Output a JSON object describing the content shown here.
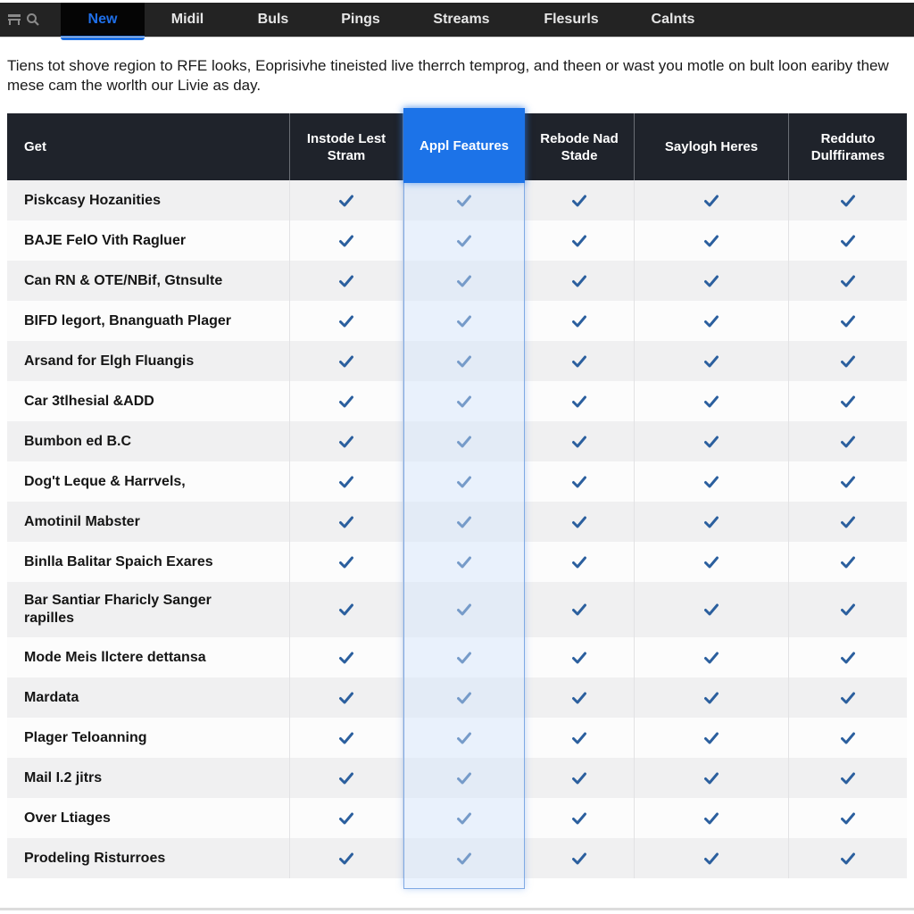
{
  "nav": {
    "icons": [
      "menu-icon",
      "search-icon"
    ],
    "tabs": [
      {
        "label": "New",
        "active": true
      },
      {
        "label": "Midil",
        "active": false
      },
      {
        "label": "Buls",
        "active": false
      },
      {
        "label": "Pings",
        "active": false
      },
      {
        "label": "Streams",
        "active": false
      },
      {
        "label": "Flesurls",
        "active": false
      },
      {
        "label": "Calnts",
        "active": false
      }
    ]
  },
  "intro": {
    "text": "Tiens tot shove region to RFE looks, Eoprisivhe tineisted live therrch temprog, and theen or wast you motle on bult loon eariby thew mese cam the worlth our Livie as day."
  },
  "table": {
    "highlight_color": "#1c73e8",
    "check_color": "#2b5f9e",
    "columns": [
      "Get",
      "Instode Lest Stram",
      "Appl Features",
      "Rebode Nad Stade",
      "Saylogh Heres",
      "Redduto Dulffirames"
    ],
    "highlighted_column_index": 2,
    "rows": [
      {
        "feature": "Piskcasy Hozanities",
        "values": [
          true,
          true,
          true,
          true,
          true
        ]
      },
      {
        "feature": "BAJE FelO Vith Ragluer",
        "values": [
          true,
          true,
          true,
          true,
          true
        ]
      },
      {
        "feature": "Can RN & OTE/NBif, Gtnsulte",
        "values": [
          true,
          true,
          true,
          true,
          true
        ]
      },
      {
        "feature": "BIFD legort, Bnanguath Plager",
        "values": [
          true,
          true,
          true,
          true,
          true
        ]
      },
      {
        "feature": "Arsand for Elgh Fluangis",
        "values": [
          true,
          true,
          true,
          true,
          true
        ]
      },
      {
        "feature": "Car 3tlhesial &ADD",
        "values": [
          true,
          true,
          true,
          true,
          true
        ]
      },
      {
        "feature": "Bumbon ed B.C",
        "values": [
          true,
          true,
          true,
          true,
          true
        ]
      },
      {
        "feature": "Dog't Leque & Harrvels,",
        "values": [
          true,
          true,
          true,
          true,
          true
        ]
      },
      {
        "feature": "Amotinil Mabster",
        "values": [
          true,
          true,
          true,
          true,
          true
        ]
      },
      {
        "feature": "Binlla Balitar Spaich Exares",
        "values": [
          true,
          true,
          true,
          true,
          true
        ]
      },
      {
        "feature": "Bar Santiar Fharicly Sanger rapilles",
        "values": [
          true,
          true,
          true,
          true,
          true
        ]
      },
      {
        "feature": "Mode Meis llctere dettansa",
        "values": [
          true,
          true,
          true,
          true,
          true
        ]
      },
      {
        "feature": "Mardata",
        "values": [
          true,
          true,
          true,
          true,
          true
        ]
      },
      {
        "feature": "Plager Teloanning",
        "values": [
          true,
          true,
          true,
          true,
          true
        ]
      },
      {
        "feature": "Mail I.2 jitrs",
        "values": [
          true,
          true,
          true,
          true,
          true
        ]
      },
      {
        "feature": "Over Ltiages",
        "values": [
          true,
          true,
          true,
          true,
          true
        ]
      },
      {
        "feature": "Prodeling Risturroes",
        "values": [
          true,
          true,
          true,
          true,
          true
        ]
      }
    ]
  }
}
